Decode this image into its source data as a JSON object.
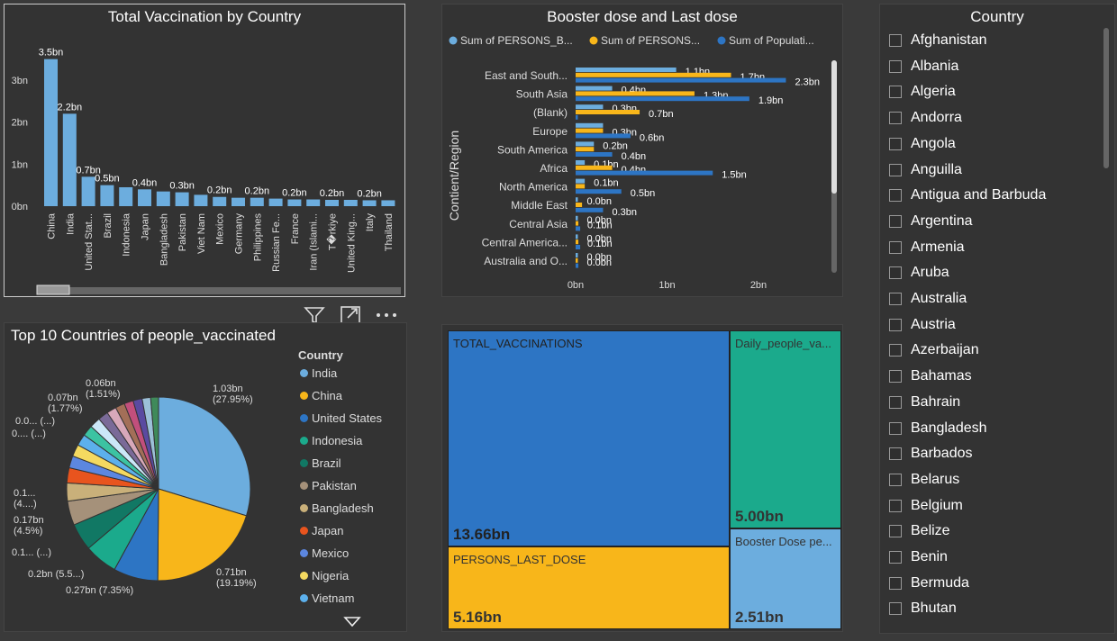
{
  "bar_panel": {
    "title": "Total Vaccination by Country"
  },
  "booster_panel": {
    "title": "Booster dose and Last dose"
  },
  "pie_panel": {
    "title": "Top 10 Countries of people_vaccinated",
    "legend_title": "Country"
  },
  "slicer": {
    "title": "Country",
    "items": [
      "Afghanistan",
      "Albania",
      "Algeria",
      "Andorra",
      "Angola",
      "Anguilla",
      "Antigua and Barbuda",
      "Argentina",
      "Armenia",
      "Aruba",
      "Australia",
      "Austria",
      "Azerbaijan",
      "Bahamas",
      "Bahrain",
      "Bangladesh",
      "Barbados",
      "Belarus",
      "Belgium",
      "Belize",
      "Benin",
      "Bermuda",
      "Bhutan"
    ]
  },
  "toolbar": {
    "filter_icon": "filter-icon",
    "focus_icon": "focus-mode-icon",
    "more_icon": "more-options-icon"
  },
  "colors": {
    "bar": "#6cadde",
    "blue": "#2d75c4",
    "yellow": "#f8b61a",
    "teal": "#1baa8c",
    "lightblue": "#6cadde"
  },
  "chart_data": [
    {
      "type": "bar",
      "title": "Total Vaccination by Country",
      "categories": [
        "China",
        "India",
        "United Stat...",
        "Brazil",
        "Indonesia",
        "Japan",
        "Bangladesh",
        "Pakistan",
        "Viet Nam",
        "Mexico",
        "Germany",
        "Philippines",
        "Russian Fe...",
        "France",
        "Iran (Islami...",
        "T�rkiye",
        "United King...",
        "Italy",
        "Thailand"
      ],
      "values": [
        3.5,
        2.2,
        0.7,
        0.5,
        0.45,
        0.4,
        0.35,
        0.33,
        0.27,
        0.22,
        0.2,
        0.2,
        0.18,
        0.16,
        0.16,
        0.15,
        0.15,
        0.14,
        0.14
      ],
      "data_labels": [
        "3.5bn",
        "2.2bn",
        "0.7bn",
        "0.5bn",
        "",
        "0.4bn",
        "",
        "0.3bn",
        "",
        "0.2bn",
        "",
        "0.2bn",
        "",
        "0.2bn",
        "",
        "0.2bn",
        "",
        "0.2bn",
        ""
      ],
      "yticks": [
        "0bn",
        "1bn",
        "2bn",
        "3bn"
      ],
      "ylim": [
        0,
        3.6
      ]
    },
    {
      "type": "bar",
      "orientation": "horizontal",
      "title": "Booster dose and Last dose",
      "ylabel": "Contient/Region",
      "categories": [
        "East and South...",
        "South Asia",
        "(Blank)",
        "Europe",
        "South America",
        "Africa",
        "North America",
        "Middle East",
        "Central Asia",
        "Central America...",
        "Australia and O..."
      ],
      "series": [
        {
          "name": "Sum of PERSONS_B...",
          "values": [
            1.1,
            0.4,
            0.3,
            0.3,
            0.2,
            0.1,
            0.1,
            0.0,
            0.0,
            0.0,
            0.0
          ],
          "labels": [
            "1.1bn",
            "0.4bn",
            "0.3bn",
            "",
            "0.2bn",
            "0.1bn",
            "0.1bn",
            "0.0bn",
            "0.0bn",
            "0.0bn",
            "0.0bn"
          ]
        },
        {
          "name": "Sum of PERSONS...",
          "values": [
            1.7,
            1.3,
            0.7,
            0.3,
            0.2,
            0.4,
            0.1,
            0.07,
            0.03,
            0.03,
            0.02
          ],
          "labels": [
            "1.7bn",
            "1.3bn",
            "0.7bn",
            "0.3bn",
            "",
            "0.4bn",
            "",
            "",
            "0.1bn",
            "0.1bn",
            "0.0bn"
          ]
        },
        {
          "name": "Sum of Populati...",
          "values": [
            2.3,
            1.9,
            0.0,
            0.6,
            0.4,
            1.5,
            0.5,
            0.3,
            0.05,
            0.05,
            0.03
          ],
          "labels": [
            "2.3bn",
            "1.9bn",
            "",
            "0.6bn",
            "0.4bn",
            "1.5bn",
            "0.5bn",
            "0.3bn",
            "",
            "",
            ""
          ]
        }
      ],
      "xticks": [
        "0bn",
        "1bn",
        "2bn"
      ],
      "xlim": [
        0,
        2.0
      ]
    },
    {
      "type": "pie",
      "title": "Top 10 Countries of people_vaccinated",
      "legend": [
        "India",
        "China",
        "United States",
        "Indonesia",
        "Brazil",
        "Pakistan",
        "Bangladesh",
        "Japan",
        "Mexico",
        "Nigeria",
        "Vietnam"
      ],
      "values": [
        27.95,
        19.19,
        7.35,
        5.5,
        4.5,
        4.0,
        3.0,
        2.5,
        2.0,
        2.0,
        1.9,
        1.8,
        1.77,
        1.7,
        1.6,
        1.55,
        1.51,
        1.5,
        1.4,
        1.3
      ],
      "labels": [
        {
          "text": "1.03bn\n(27.95%)"
        },
        {
          "text": "0.71bn\n(19.19%)"
        },
        {
          "text": "0.27bn (7.35%)"
        },
        {
          "text": "0.2bn (5.5...)"
        },
        {
          "text": "0.1... (...)"
        },
        {
          "text": "0.17bn\n(4.5%)"
        },
        {
          "text": "0.1...\n(4....)"
        },
        {
          "text": "0.... (...)"
        },
        {
          "text": "0.0... (...)"
        },
        {
          "text": "0.07bn\n(1.77%)"
        },
        {
          "text": "0.06bn\n(1.51%)"
        }
      ]
    },
    {
      "type": "treemap",
      "items": [
        {
          "label": "TOTAL_VACCINATIONS",
          "value": "13.66bn"
        },
        {
          "label": "Daily_people_va...",
          "value": "5.00bn"
        },
        {
          "label": "PERSONS_LAST_DOSE",
          "value": "5.16bn"
        },
        {
          "label": "Booster Dose pe...",
          "value": "2.51bn"
        }
      ]
    }
  ]
}
